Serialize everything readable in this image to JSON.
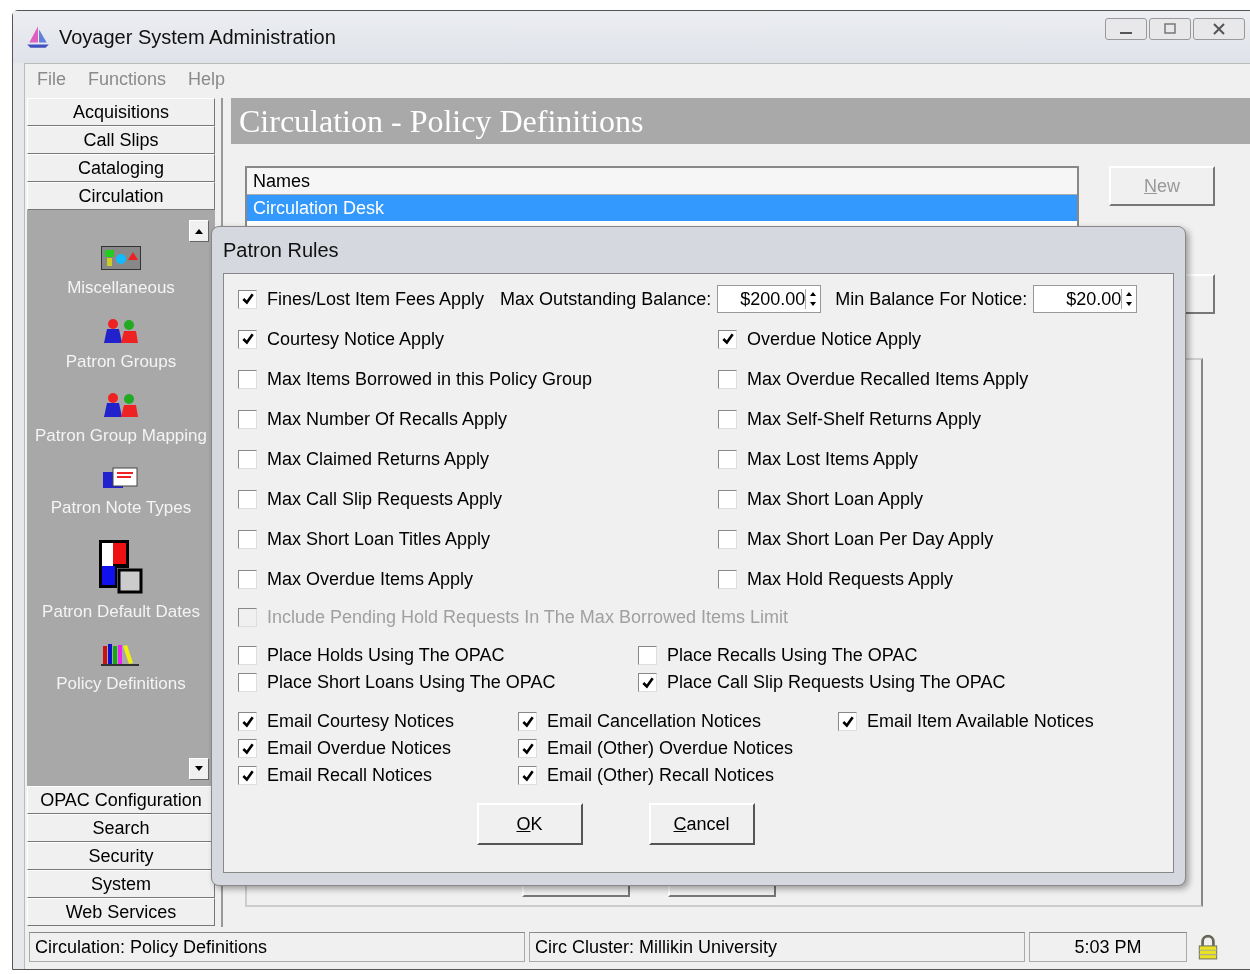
{
  "window": {
    "title": "Voyager System Administration"
  },
  "menu": [
    "File",
    "Functions",
    "Help"
  ],
  "sidebar": {
    "top_buttons": [
      "Acquisitions",
      "Call Slips",
      "Cataloging",
      "Circulation"
    ],
    "panel_items": [
      "Miscellaneous",
      "Patron Groups",
      "Patron Group Mapping",
      "Patron Note Types",
      "Patron Default Dates",
      "Policy Definitions"
    ],
    "bottom_buttons": [
      "OPAC Configuration",
      "Search",
      "Security",
      "System",
      "Web Services"
    ]
  },
  "main": {
    "header": "Circulation - Policy Definitions",
    "names_list": {
      "column_header": "Names",
      "rows": [
        {
          "text": "Circulation Desk",
          "selected": true
        }
      ]
    },
    "new_button": {
      "label": "New",
      "disabled": true
    }
  },
  "dialog": {
    "title": "Patron Rules",
    "fines": {
      "label": "Fines/Lost Item Fees Apply",
      "checked": true
    },
    "balance_fields": [
      {
        "label": "Max Outstanding Balance:",
        "value": "$200.00"
      },
      {
        "label": "Min Balance For Notice:",
        "value": "$20.00"
      }
    ],
    "rules": [
      {
        "label": "Courtesy Notice Apply",
        "checked": true
      },
      {
        "label": "Overdue Notice Apply",
        "checked": true
      },
      {
        "label": "Max Items Borrowed in this Policy Group",
        "checked": false
      },
      {
        "label": "Max Overdue Recalled Items Apply",
        "checked": false
      },
      {
        "label": "Max Number Of Recalls Apply",
        "checked": false
      },
      {
        "label": "Max Self-Shelf Returns Apply",
        "checked": false
      },
      {
        "label": "Max Claimed Returns Apply",
        "checked": false
      },
      {
        "label": "Max Lost Items Apply",
        "checked": false
      },
      {
        "label": "Max Call Slip Requests Apply",
        "checked": false
      },
      {
        "label": "Max Short Loan Apply",
        "checked": false
      },
      {
        "label": "Max Short Loan Titles Apply",
        "checked": false
      },
      {
        "label": "Max Short Loan Per Day Apply",
        "checked": false
      },
      {
        "label": "Max Overdue Items Apply",
        "checked": false
      },
      {
        "label": "Max Hold Requests Apply",
        "checked": false
      }
    ],
    "include_pending": {
      "label": "Include Pending Hold Requests In The Max Borrowed Items Limit",
      "checked": false,
      "disabled": true
    },
    "opac_options": [
      {
        "label": "Place Holds Using The OPAC",
        "checked": false
      },
      {
        "label": "Place Recalls Using The OPAC",
        "checked": false
      },
      {
        "label": "Place Short Loans Using The OPAC",
        "checked": false
      },
      {
        "label": "Place Call Slip Requests Using The OPAC",
        "checked": true
      }
    ],
    "email_options": [
      {
        "label": "Email Courtesy Notices",
        "checked": true
      },
      {
        "label": "Email Overdue Notices",
        "checked": true
      },
      {
        "label": "Email Recall Notices",
        "checked": true
      },
      {
        "label": "Email Cancellation Notices",
        "checked": true
      },
      {
        "label": "Email (Other) Overdue Notices",
        "checked": true
      },
      {
        "label": "Email (Other) Recall Notices",
        "checked": true
      },
      {
        "label": "Email Item Available Notices",
        "checked": true
      }
    ],
    "buttons": [
      "OK",
      "Cancel"
    ]
  },
  "status_bar": [
    "Circulation:  Policy Definitions",
    "Circ Cluster:  Millikin University",
    "5:03 PM"
  ]
}
